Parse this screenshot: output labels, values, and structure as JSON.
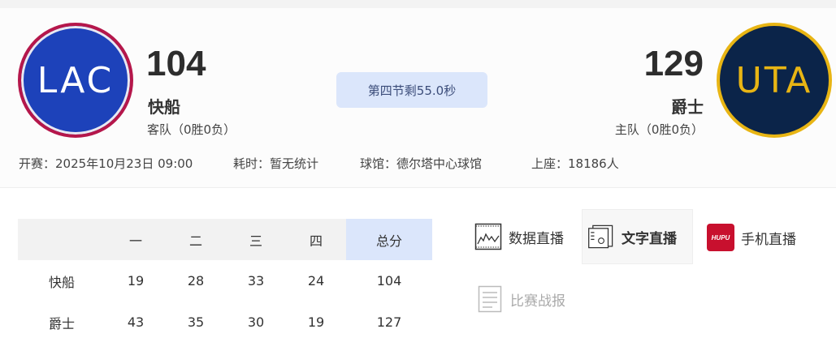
{
  "away": {
    "abbr": "LAC",
    "score": "104",
    "name": "快船",
    "role": "客队（0胜0负）",
    "color_primary": "#1d42ba",
    "color_ring": "#b5174b"
  },
  "home": {
    "abbr": "UTA",
    "score": "129",
    "name": "爵士",
    "role": "主队（0胜0负）",
    "color_primary": "#0b2449",
    "color_ring": "#e8b514"
  },
  "status": "第四节剩55.0秒",
  "meta": {
    "start": "开赛：2025年10月23日 09:00",
    "duration": "耗时：暂无统计",
    "venue": "球馆：德尔塔中心球馆",
    "attendance": "上座：18186人"
  },
  "boxscore": {
    "headers": [
      "",
      "一",
      "二",
      "三",
      "四",
      "总分"
    ],
    "rows": [
      [
        "快船",
        "19",
        "28",
        "33",
        "24",
        "104"
      ],
      [
        "爵士",
        "43",
        "35",
        "30",
        "19",
        "127"
      ]
    ]
  },
  "links": {
    "data_live": "数据直播",
    "text_live": "文字直播",
    "mobile_live": "手机直播",
    "mobile_icon_text": "HUPU",
    "report": "比赛战报"
  }
}
